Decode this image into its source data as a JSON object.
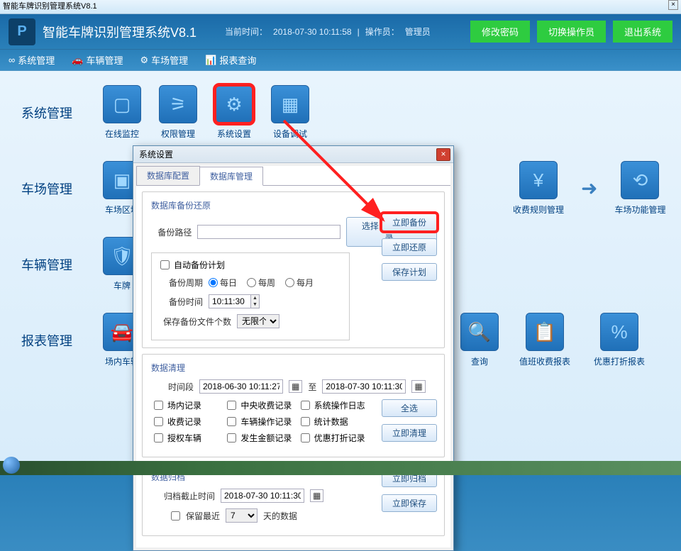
{
  "titlebar": {
    "text": "智能车牌识别管理系统V8.1",
    "close": "×"
  },
  "header": {
    "app_title": "智能车牌识别管理系统V8.1",
    "time_label": "当前时间：",
    "time_value": "2018-07-30 10:11:58",
    "sep": "|",
    "operator_label": "操作员：",
    "operator_value": "管理员",
    "btn_pwd": "修改密码",
    "btn_switch": "切换操作员",
    "btn_exit": "退出系统"
  },
  "menubar": {
    "sys": "系统管理",
    "vehicle": "车辆管理",
    "lot": "车场管理",
    "report": "报表查询"
  },
  "sections": {
    "sys": {
      "label": "系统管理",
      "tiles": {
        "monitor": "在线监控",
        "perm": "权限管理",
        "settings": "系统设置",
        "device": "设备调试"
      }
    },
    "lot": {
      "label": "车场管理",
      "tiles": {
        "area": "车场区域",
        "fee": "收费规则管理",
        "func": "车场功能管理"
      }
    },
    "vehicle": {
      "label": "车辆管理",
      "tiles": {
        "plate": "车牌"
      }
    },
    "report": {
      "label": "报表管理",
      "tiles": {
        "in": "场内车辆",
        "query": "查询",
        "duty": "值班收费报表",
        "discount": "优惠打折报表"
      }
    }
  },
  "dialog": {
    "title": "系统设置",
    "close": "×",
    "tabs": {
      "db_conf": "数据库配置",
      "db_mgmt": "数据库管理"
    },
    "backup": {
      "legend": "数据库备份还原",
      "path_label": "备份路径",
      "path_value": "",
      "choose_dir": "选择自动备份目录..",
      "auto_plan": "自动备份计划",
      "cycle_label": "备份周期",
      "cycle_options": {
        "day": "每日",
        "week": "每周",
        "month": "每月"
      },
      "time_label": "备份时间",
      "time_value": "10:11:30",
      "keep_label": "保存备份文件个数",
      "keep_value": "无限个",
      "btn_backup": "立即备份",
      "btn_restore": "立即还原",
      "btn_save_plan": "保存计划"
    },
    "clean": {
      "legend": "数据清理",
      "range_label": "时间段",
      "from": "2018-06-30 10:11:27",
      "to_label": "至",
      "to": "2018-07-30 10:11:30",
      "checks": {
        "in_rec": "场内记录",
        "central_fee": "中央收费记录",
        "sys_log": "系统操作日志",
        "fee_rec": "收费记录",
        "op_rec": "车辆操作记录",
        "stats": "统计数据",
        "auth_vehicle": "授权车辆",
        "amount_rec": "发生金额记录",
        "discount_rec": "优惠打折记录"
      },
      "btn_all": "全选",
      "btn_clean": "立即清理"
    },
    "archive": {
      "legend": "数据归档",
      "deadline_label": "归档截止时间",
      "deadline_value": "2018-07-30 10:11:30",
      "keep_label": "保留最近",
      "keep_value": "7",
      "keep_suffix": "天的数据",
      "btn_archive": "立即归档",
      "btn_save": "立即保存"
    }
  }
}
